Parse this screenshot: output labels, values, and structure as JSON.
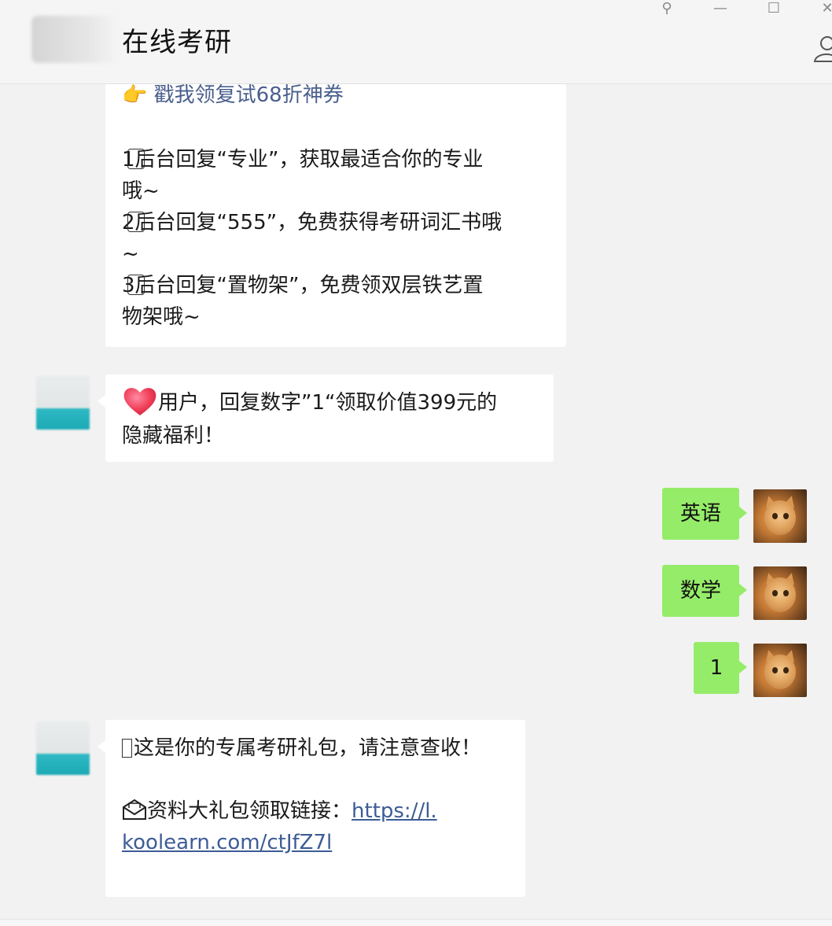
{
  "window": {
    "title": "在线考研",
    "controls": {
      "pin": "⚲",
      "minimize": "—",
      "maximize": "☐",
      "close": "✕"
    }
  },
  "messages": [
    {
      "side": "in",
      "lines": {
        "coupon_emoji": "👉",
        "coupon_link": "戳我领复试68折神券",
        "l1a": "1",
        "l1b": "后台回复“专业”，获取最适合你的专业",
        "l1c": "哦~",
        "l2a": "2",
        "l2b": "后台回复“555”，免费获得考研词汇书哦",
        "l2c": "~",
        "l3a": "3",
        "l3b": "后台回复“置物架”，免费领双层铁艺置",
        "l3c": "物架哦~"
      }
    },
    {
      "side": "in",
      "lines": {
        "l1": "用户，回复数字”1“领取价值399元的",
        "l2": "隐藏福利！"
      }
    },
    {
      "side": "out",
      "text": "英语"
    },
    {
      "side": "out",
      "text": "数学"
    },
    {
      "side": "out",
      "text": "1"
    },
    {
      "side": "in",
      "lines": {
        "l1": "这是你的专属考研礼包，请注意查收！",
        "l2": "资料大礼包领取链接：",
        "link_a": "https://l.",
        "link_b": "koolearn.com/ctJfZ7l"
      }
    }
  ],
  "icons": {
    "pin": "pin-icon",
    "minimize": "minimize-icon",
    "maximize": "maximize-icon",
    "close": "close-icon",
    "contact": "contact-icon",
    "heart": "heart-icon",
    "envelope": "envelope-icon",
    "point": "pointing-hand-icon"
  },
  "colors": {
    "out_bubble": "#95ec69",
    "in_bubble": "#ffffff",
    "background": "#f2f2f2",
    "link": "#3d5c96"
  }
}
